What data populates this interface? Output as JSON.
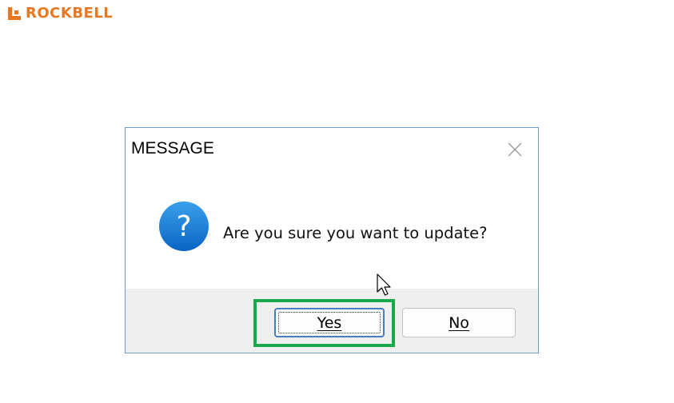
{
  "brand": {
    "name": "ROCKBELL",
    "color": "#e87722"
  },
  "dialog": {
    "title": "MESSAGE",
    "message": "Are you sure you want to update?",
    "icon": "question-icon",
    "buttons": {
      "yes": {
        "label": "Yes",
        "accelerator": "Y"
      },
      "no": {
        "label": "No",
        "accelerator": "N"
      }
    }
  },
  "annotation": {
    "highlight_color": "#1aa84b",
    "highlighted": "yes-button"
  }
}
